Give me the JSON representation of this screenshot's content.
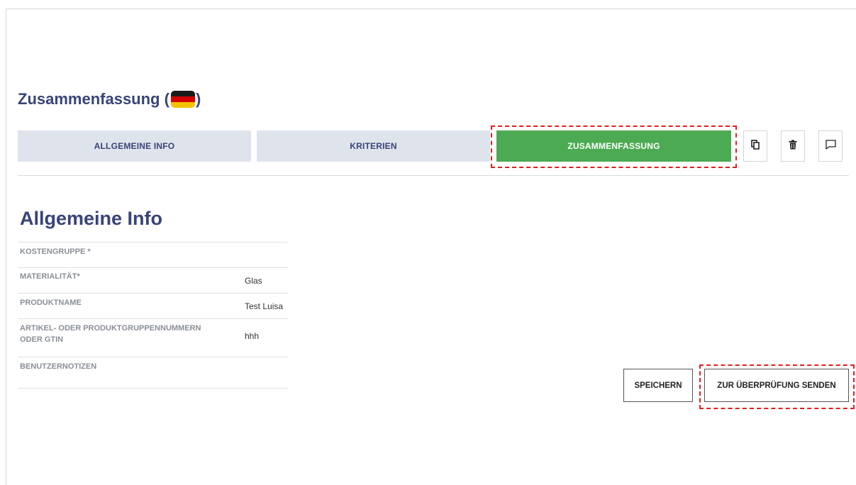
{
  "page": {
    "title": "Zusammenfassung (",
    "title_suffix": ")",
    "flag_icon": "germany-flag-icon"
  },
  "tabs": [
    {
      "label": "ALLGEMEINE INFO",
      "active": false
    },
    {
      "label": "KRITERIEN",
      "active": false
    },
    {
      "label": "ZUSAMMENFASSUNG",
      "active": true,
      "highlighted": true
    }
  ],
  "toolbar": {
    "icons": [
      "copy-icon",
      "trash-icon",
      "comment-icon"
    ]
  },
  "section": {
    "title": "Allgemeine Info"
  },
  "info_rows": [
    {
      "label": "KOSTENGRUPPE *",
      "value": ""
    },
    {
      "label": "MATERIALITÄT*",
      "value": "Glas"
    },
    {
      "label": "PRODUKTNAME",
      "value": "Test Luisa"
    },
    {
      "label": "ARTIKEL- ODER PRODUKTGRUPPENNUMMERN ODER GTIN",
      "value": "hhh"
    },
    {
      "label": "BENUTZERNOTIZEN",
      "value": ""
    }
  ],
  "actions": {
    "save_label": "SPEICHERN",
    "submit_label": "ZUR ÜBERPRÜFUNG SENDEN",
    "submit_highlighted": true
  },
  "colors": {
    "accent": "#4caa52",
    "heading": "#3a4378",
    "tab_inactive_bg": "#dfe3ec",
    "highlight": "#e02020"
  }
}
